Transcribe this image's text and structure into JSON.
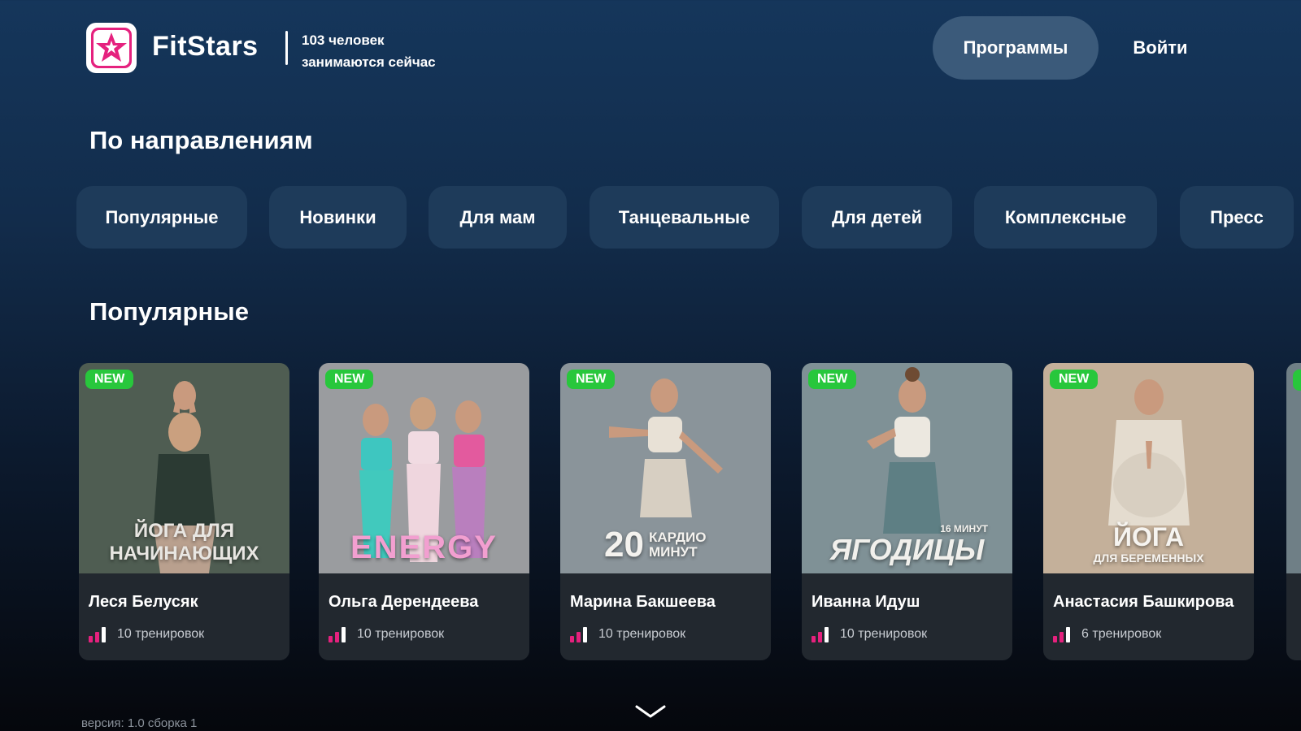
{
  "header": {
    "brand": "FitStars",
    "live_count": "103 человек",
    "live_text": "занимаются сейчас",
    "nav_programs": "Программы",
    "nav_login": "Войти"
  },
  "categories": {
    "title": "По направлениям",
    "items": [
      "Популярные",
      "Новинки",
      "Для мам",
      "Танцевальные",
      "Для детей",
      "Комплексные",
      "Пресс"
    ]
  },
  "popular": {
    "title": "Популярные",
    "cards": [
      {
        "badge": "NEW",
        "overlay_line1": "ЙОГА ДЛЯ",
        "overlay_line2": "НАЧИНАЮЩИХ",
        "author": "Леся Белусяк",
        "count": "10",
        "count_label": "тренировок"
      },
      {
        "badge": "NEW",
        "overlay_line1": "ENERGY",
        "overlay_line2": "",
        "author": "Ольга Дерендеева",
        "count": "10",
        "count_label": "тренировок"
      },
      {
        "badge": "NEW",
        "overlay_line1": "20",
        "overlay_line2": "КАРДИО МИНУТ",
        "author": "Марина Бакшеева",
        "count": "10",
        "count_label": "тренировок"
      },
      {
        "badge": "NEW",
        "overlay_line1": "16 МИНУТ",
        "overlay_line2": "ЯГОДИЦЫ",
        "author": "Иванна Идуш",
        "count": "10",
        "count_label": "тренировок"
      },
      {
        "badge": "NEW",
        "overlay_line1": "ЙОГА",
        "overlay_line2": "ДЛЯ БЕРЕМЕННЫХ",
        "author": "Анастасия Башкирова",
        "count": "6",
        "count_label": "тренировок"
      }
    ]
  },
  "footer": {
    "version": "версия: 1.0 сборка 1"
  },
  "colors": {
    "accent_pink": "#e5217e",
    "badge_green": "#28c73c",
    "chip_bg": "#1e3b5a",
    "card_bg": "#22282f"
  },
  "icons": [
    "fitstars-star-logo",
    "level-bars-icon",
    "chevron-down-icon"
  ]
}
